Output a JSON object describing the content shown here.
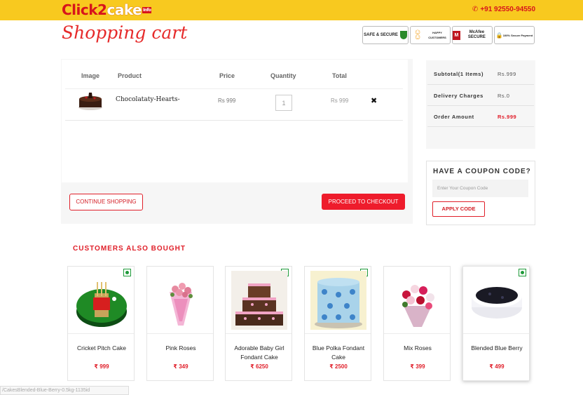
{
  "header": {
    "logo": {
      "part1": "Click",
      "part2": "2",
      "part3": "cake",
      "tag": "Info"
    },
    "phone": "+91 92550-94550",
    "colors": {
      "bar": "#f8c91f",
      "brand_red": "#d7141b"
    }
  },
  "page_title": "Shopping cart",
  "trust_badges": [
    {
      "icon": "shield-icon",
      "label": "SAFE & SECURE"
    },
    {
      "icon": "smiley-icon",
      "label": "HAPPY CUSTOMERS"
    },
    {
      "icon": "mcafee-icon",
      "label": "McAfee SECURE"
    },
    {
      "icon": "lock-icon",
      "label": "100% Secure Payment"
    }
  ],
  "cart": {
    "columns": [
      "Image",
      "Product",
      "Price",
      "Quantity",
      "Total"
    ],
    "rows": [
      {
        "product": "Chocolataty-Hearts-",
        "price": "Rs 999",
        "quantity": "1",
        "total": "Rs 999",
        "remove": "✖"
      }
    ],
    "continue_label": "CONTINUE SHOPPING",
    "checkout_label": "PROCEED TO CHECKOUT"
  },
  "summary": {
    "subtotal_label": "Subtotal(1 Items)",
    "subtotal_value": "Rs.999",
    "delivery_label": "Delivery Charges",
    "delivery_value": "Rs.0",
    "order_label": "Order Amount",
    "order_value": "Rs.999"
  },
  "coupon": {
    "title": "HAVE A COUPON CODE?",
    "placeholder": "Enter Your Coupon Code",
    "apply_label": "APPLY CODE"
  },
  "also_bought": {
    "title": "CUSTOMERS ALSO BOUGHT",
    "items": [
      {
        "name": "Cricket Pitch Cake",
        "price": "₹ 999",
        "icon": "cricket-cake-image"
      },
      {
        "name": "Pink Roses",
        "price": "₹ 349",
        "icon": "pink-roses-image"
      },
      {
        "name": "Adorable Baby Girl Fondant Cake",
        "price": "₹ 6250",
        "icon": "tier-cake-image"
      },
      {
        "name": "Blue Polka Fondant Cake",
        "price": "₹ 2500",
        "icon": "polka-cake-image"
      },
      {
        "name": "Mix Roses",
        "price": "₹ 399",
        "icon": "mix-roses-image"
      },
      {
        "name": "Blended Blue Berry",
        "price": "₹ 499",
        "icon": "blueberry-cake-image"
      }
    ]
  },
  "status_url": "/CakesBlended-Blue-Berry-0.5kg-1135id"
}
